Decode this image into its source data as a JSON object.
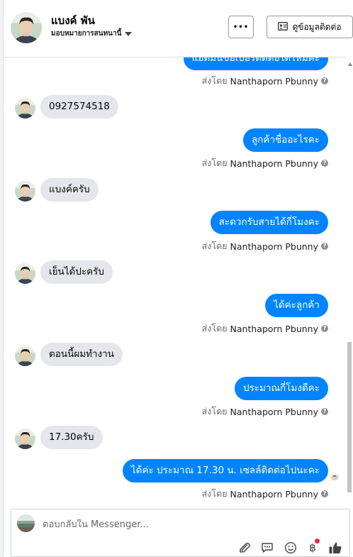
{
  "header": {
    "contact_name": "แบงค์ พัน",
    "assignment_label": "มอบหมายการสนทนานี้",
    "more_button_label": "•••",
    "contact_info_button_label": "ดูข้อมูลติดต่อ"
  },
  "thread": {
    "partial_top_message": "แอดมินขอเบอร์ติดต่อได้ไหมคะ",
    "sent_by_prefix": "ส่งโดย",
    "sender_name": "Nanthaporn Pbunny",
    "messages": [
      {
        "dir": "in",
        "text": "0927574518"
      },
      {
        "dir": "out",
        "text": "ลูกค้าชื่ออะไรคะ"
      },
      {
        "dir": "in",
        "text": "แบงค์ครับ"
      },
      {
        "dir": "out",
        "text": "สะดวกรับสายได้กี่โมงคะ"
      },
      {
        "dir": "in",
        "text": "เย็นได้ปะครับ"
      },
      {
        "dir": "out",
        "text": "ได้ค่ะลูกค้า"
      },
      {
        "dir": "in",
        "text": "ตอนนี้ผมทำงาน"
      },
      {
        "dir": "out",
        "text": "ประมาณกี่โมงดีคะ"
      },
      {
        "dir": "in",
        "text": "17.30ครับ"
      },
      {
        "dir": "out",
        "text": "ได้ค่ะ ประมาณ 17.30 น. เซลล์ติดต่อไปนะคะ"
      }
    ]
  },
  "composer": {
    "placeholder": "ตอบกลับใน Messenger..."
  },
  "colors": {
    "outgoing_bubble": "#0084ff",
    "incoming_bubble": "#e4e6eb",
    "notification_dot": "#f02849"
  }
}
